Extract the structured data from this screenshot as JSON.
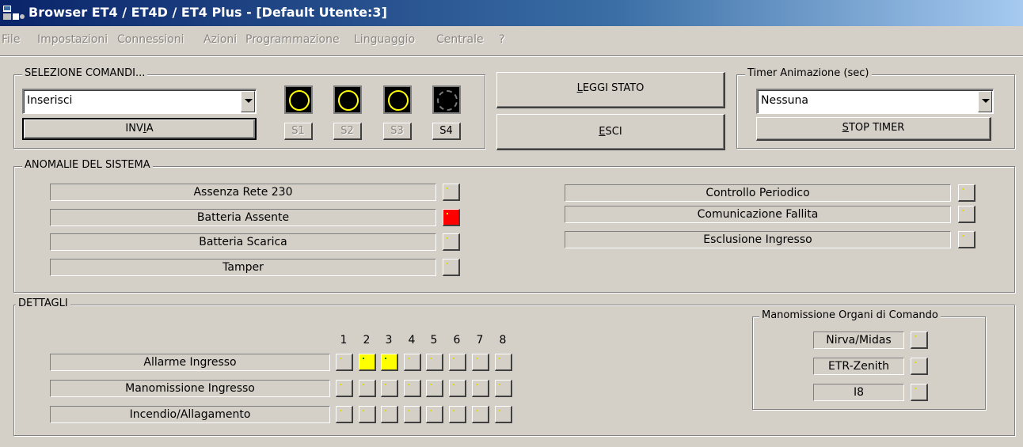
{
  "window": {
    "title": "Browser ET4 / ET4D / ET4 Plus - [Default Utente:3]"
  },
  "menu": [
    "File",
    "Impostazioni",
    "Connessioni",
    "Azioni",
    "Programmazione",
    "Linguaggio",
    "Centrale",
    "?"
  ],
  "selezione": {
    "label": "SELEZIONE COMANDI...",
    "combo_value": "Inserisci",
    "invia_pre": "INV",
    "invia_u": "I",
    "invia_post": "A",
    "sectors": [
      {
        "label": "S1",
        "lit": true,
        "enabled": false
      },
      {
        "label": "S2",
        "lit": true,
        "enabled": false
      },
      {
        "label": "S3",
        "lit": true,
        "enabled": false
      },
      {
        "label": "S4",
        "lit": false,
        "enabled": true
      }
    ]
  },
  "actions": {
    "leggi_u": "L",
    "leggi_rest": "EGGI STATO",
    "esci_u": "E",
    "esci_rest": "SCI"
  },
  "timer": {
    "label": "Timer Animazione (sec)",
    "combo_value": "Nessuna",
    "stop_u": "S",
    "stop_rest": "TOP TIMER"
  },
  "anomalie": {
    "label": "ANOMALIE  DEL  SISTEMA",
    "left": [
      {
        "label": "Assenza Rete 230",
        "state": "off"
      },
      {
        "label": "Batteria Assente",
        "state": "alarm"
      },
      {
        "label": "Batteria Scarica",
        "state": "off"
      },
      {
        "label": "Tamper",
        "state": "off"
      }
    ],
    "right": [
      {
        "label": "Controllo Periodico",
        "state": "off"
      },
      {
        "label": "Comunicazione Fallita",
        "state": "off"
      },
      {
        "label": "Esclusione Ingresso",
        "state": "off"
      }
    ]
  },
  "dettagli": {
    "label": "DETTAGLI",
    "columns": [
      "1",
      "2",
      "3",
      "4",
      "5",
      "6",
      "7",
      "8"
    ],
    "rows": [
      {
        "label": "Allarme Ingresso",
        "states": [
          "off",
          "on",
          "on",
          "off",
          "off",
          "off",
          "off",
          "off"
        ]
      },
      {
        "label": "Manomissione Ingresso",
        "states": [
          "off",
          "off",
          "off",
          "off",
          "off",
          "off",
          "off",
          "off"
        ]
      },
      {
        "label": "Incendio/Allagamento",
        "states": [
          "off",
          "off",
          "off",
          "off",
          "off",
          "off",
          "off",
          "off"
        ]
      }
    ]
  },
  "manomissione": {
    "label": "Manomissione Organi di Comando",
    "items": [
      {
        "label": "Nirva/Midas",
        "state": "off"
      },
      {
        "label": "ETR-Zenith",
        "state": "off"
      },
      {
        "label": "I8",
        "state": "off"
      }
    ]
  },
  "colors": {
    "face": "#d4d0c8",
    "title_start": "#0a246a",
    "alarm": "#ff0000",
    "active": "#ffff00"
  }
}
